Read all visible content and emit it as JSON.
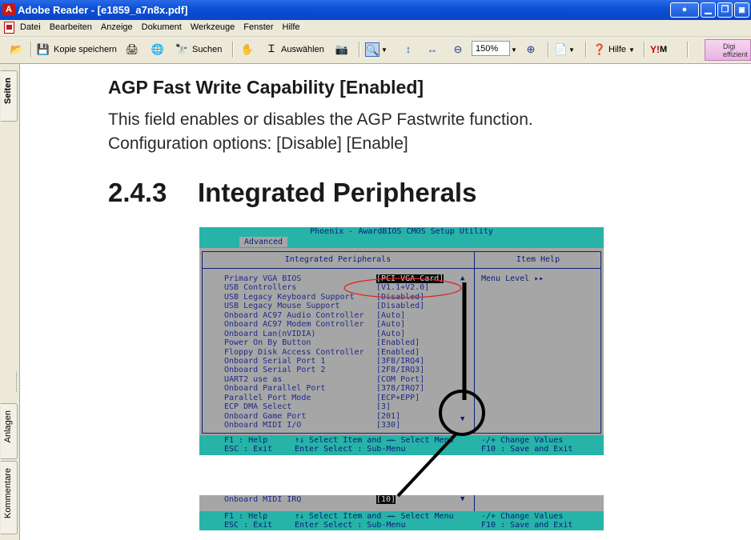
{
  "window": {
    "title": "Adobe Reader - [e1859_a7n8x.pdf]",
    "buttons": [
      "minimize",
      "restore",
      "close"
    ]
  },
  "menu": [
    "Datei",
    "Bearbeiten",
    "Anzeige",
    "Dokument",
    "Werkzeuge",
    "Fenster",
    "Hilfe"
  ],
  "toolbar": {
    "save_label": "Kopie speichern",
    "search_label": "Suchen",
    "select_label": "Auswählen",
    "zoom_value": "150%",
    "help_label": "Hilfe",
    "ad_text": "Digi effizient"
  },
  "side_tabs": {
    "pages": "Seiten",
    "attachments": "Anlagen",
    "comments": "Kommentare"
  },
  "document": {
    "heading_agp": "AGP Fast Write Capability [Enabled]",
    "para1": "This field enables or disables the AGP Fastwrite function.",
    "para2": "Configuration options: [Disable] [Enable]",
    "section_num": "2.4.3",
    "section_title": "Integrated Peripherals"
  },
  "bios": {
    "title": "Phoenix - AwardBIOS CMOS Setup Utility",
    "tab": "Advanced",
    "panel_title": "Integrated Peripherals",
    "help_title": "Item Help",
    "menu_level": "Menu Level   ▸▸",
    "rows": [
      {
        "label": "Primary VGA BIOS",
        "value": "[PCI VGA Card]"
      },
      {
        "label": "USB Controllers",
        "value": "[V1.1+V2.0]"
      },
      {
        "label": "USB Legacy Keyboard Support",
        "value": "[Disabled]"
      },
      {
        "label": "USB Legacy Mouse Support",
        "value": "[Disabled]"
      },
      {
        "label": "Onboard AC97 Audio Controller",
        "value": "[Auto]"
      },
      {
        "label": "Onboard AC97 Modem Controller",
        "value": "[Auto]"
      },
      {
        "label": "Onboard Lan(nVIDIA)",
        "value": "[Auto]"
      },
      {
        "label": "Power On By Button",
        "value": "[Enabled]"
      },
      {
        "label": "Floppy Disk Access Controller",
        "value": "[Enabled]"
      },
      {
        "label": "Onboard Serial Port 1",
        "value": "[3F8/IRQ4]"
      },
      {
        "label": "Onboard Serial Port 2",
        "value": "[2F8/IRQ3]"
      },
      {
        "label": "UART2 use as",
        "value": "[COM Port]"
      },
      {
        "label": "Onboard Parallel Port",
        "value": "[378/IRQ7]"
      },
      {
        "label": "Parallel Port Mode",
        "value": "[ECP+EPP]"
      },
      {
        "label": "ECP DMA Select",
        "value": "[3]"
      },
      {
        "label": "Onboard Game Port",
        "value": "[201]"
      },
      {
        "label": "Onboard MIDI I/O",
        "value": "[330]"
      }
    ],
    "footer": {
      "f1": "F1  : Help",
      "esc": "ESC : Exit",
      "select_item": "↑↓ Select Item and →← Select Menu",
      "enter": "Enter Select : Sub-Menu",
      "change": "-/+ Change Values",
      "f10": "F10 : Save and Exit"
    },
    "continued_row": {
      "label": "Onboard MIDI IRQ",
      "value": "[10]"
    }
  },
  "colors": {
    "titlebar": "#0a4fd6",
    "chrome": "#ece9d8",
    "bios_bg": "#a6a6a6",
    "bios_bar": "#27b3a8",
    "bios_text": "#1e2a8a",
    "annotation_red": "#e02020"
  }
}
